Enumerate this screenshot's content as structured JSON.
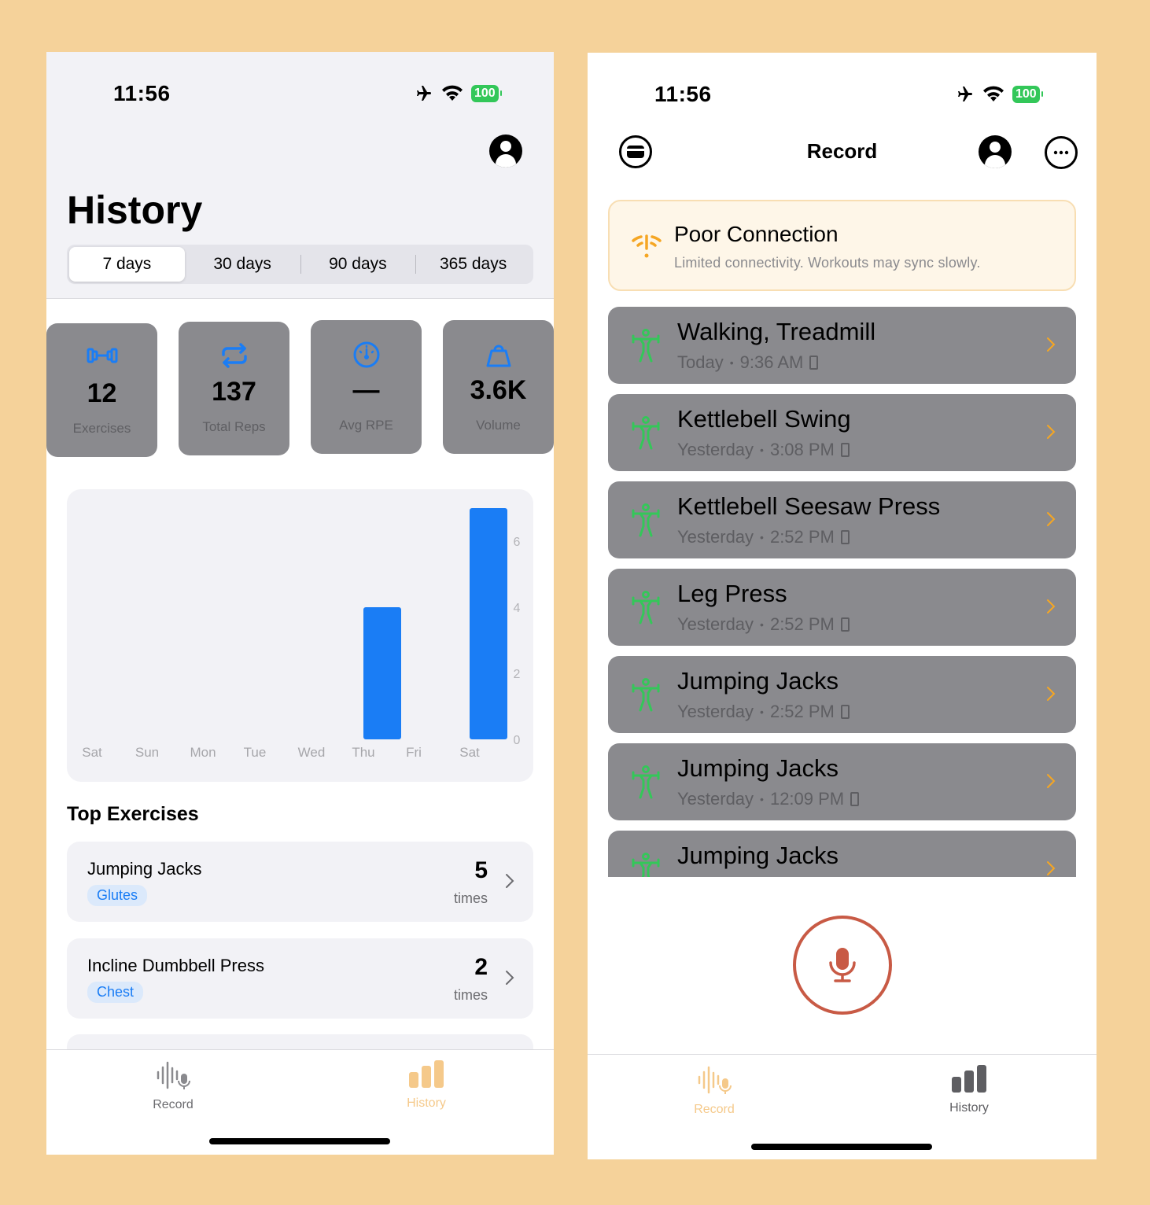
{
  "history_screen": {
    "status": {
      "time": "11:56",
      "battery": "100"
    },
    "title": "History",
    "range_tabs": [
      {
        "label": "7 days",
        "active": true
      },
      {
        "label": "30 days",
        "active": false
      },
      {
        "label": "90 days",
        "active": false
      },
      {
        "label": "365 days",
        "active": false
      }
    ],
    "stats": [
      {
        "value": "12",
        "label": "Exercises",
        "icon": "dumbbell-icon"
      },
      {
        "value": "137",
        "label": "Total Reps",
        "icon": "repeat-icon"
      },
      {
        "value": "—",
        "label": "Avg RPE",
        "icon": "gauge-icon"
      },
      {
        "value": "3.6K",
        "label": "Volume",
        "icon": "kettlebell-icon"
      }
    ],
    "chart_data": {
      "type": "bar",
      "categories": [
        "Sat",
        "Sun",
        "Mon",
        "Tue",
        "Wed",
        "Thu",
        "Fri",
        "Sat"
      ],
      "values": [
        0,
        0,
        0,
        0,
        0,
        4,
        0,
        7
      ],
      "y_ticks": [
        "0",
        "2",
        "4",
        "6"
      ],
      "ylim": [
        0,
        7
      ],
      "y_axis_position": "right",
      "grid": false,
      "bar_color": "#1a7df5"
    },
    "top_exercises_title": "Top Exercises",
    "top_exercises": [
      {
        "name": "Jumping Jacks",
        "tag": "Glutes",
        "count": "5",
        "unit": "times"
      },
      {
        "name": "Incline Dumbbell Press",
        "tag": "Chest",
        "count": "2",
        "unit": "times"
      }
    ],
    "tabbar": {
      "record_label": "Record",
      "history_label": "History",
      "active": "history",
      "active_color": "#f5c98a",
      "inactive_color": "#8a8a8e"
    }
  },
  "record_screen": {
    "status": {
      "time": "11:56",
      "battery": "100"
    },
    "title": "Record",
    "banner": {
      "title": "Poor Connection",
      "subtitle": "Limited connectivity. Workouts may sync slowly.",
      "icon": "wifi-warning-icon",
      "accent": "#f5a623"
    },
    "workouts": [
      {
        "name": "Walking, Treadmill",
        "day": "Today",
        "time": "9:36 AM"
      },
      {
        "name": "Kettlebell Swing",
        "day": "Yesterday",
        "time": "3:08 PM"
      },
      {
        "name": "Kettlebell Seesaw Press",
        "day": "Yesterday",
        "time": "2:52 PM"
      },
      {
        "name": "Leg Press",
        "day": "Yesterday",
        "time": "2:52 PM"
      },
      {
        "name": "Jumping Jacks",
        "day": "Yesterday",
        "time": "2:52 PM"
      },
      {
        "name": "Jumping Jacks",
        "day": "Yesterday",
        "time": "12:09 PM"
      },
      {
        "name": "Jumping Jacks",
        "day": "",
        "time": ""
      }
    ],
    "separator": "•",
    "accent_green": "#34c759",
    "mic_color": "#c85a45",
    "tabbar": {
      "record_label": "Record",
      "history_label": "History",
      "active": "record"
    }
  }
}
